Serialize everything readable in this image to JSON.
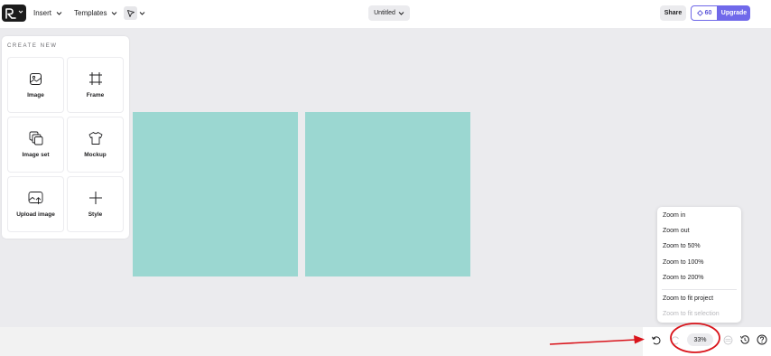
{
  "topbar": {
    "insert_label": "Insert",
    "templates_label": "Templates",
    "document_title": "Untitled",
    "share_label": "Share",
    "credits_count": "60",
    "upgrade_label": "Upgrade"
  },
  "create_panel": {
    "title": "CREATE NEW",
    "items": [
      {
        "label": "Image",
        "icon": "image-icon"
      },
      {
        "label": "Frame",
        "icon": "frame-icon"
      },
      {
        "label": "Image set",
        "icon": "image-set-icon"
      },
      {
        "label": "Mockup",
        "icon": "shirt-icon"
      },
      {
        "label": "Upload image",
        "icon": "upload-image-icon"
      },
      {
        "label": "Style",
        "icon": "style-icon"
      }
    ]
  },
  "zoom_menu": {
    "items": [
      {
        "label": "Zoom in",
        "enabled": true
      },
      {
        "label": "Zoom out",
        "enabled": true
      },
      {
        "label": "Zoom to 50%",
        "enabled": true
      },
      {
        "label": "Zoom to 100%",
        "enabled": true
      },
      {
        "label": "Zoom to 200%",
        "enabled": true
      },
      {
        "label": "Zoom to fit project",
        "enabled": true
      },
      {
        "label": "Zoom to fit selection",
        "enabled": false
      }
    ]
  },
  "bottom": {
    "zoom_level": "33%"
  },
  "colors": {
    "canvas_fill": "#9bd7d1",
    "accent": "#7069ea",
    "annotation": "#d9141b"
  }
}
